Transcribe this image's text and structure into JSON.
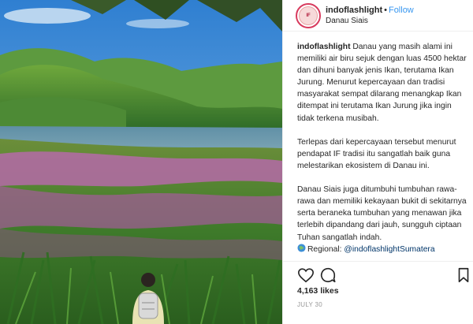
{
  "post": {
    "username": "indoflashlight",
    "follow_label": "Follow",
    "separator": "•",
    "location": "Danau Siais",
    "avatar_mark": "IF",
    "caption": {
      "paragraph1": "Danau yang masih alami ini memiliki air biru sejuk dengan luas 4500 hektar dan dihuni banyak jenis Ikan, terutama Ikan Jurung. Menurut kepercayaan dan tradisi masyarakat sempat dilarang menangkap Ikan ditempat ini terutama Ikan Jurung jika ingin tidak terkena musibah.",
      "paragraph2": "Terlepas dari kepercayaan tersebut menurut pendapat IF tradisi itu sangatlah baik guna melestarikan ekosistem di Danau ini.",
      "paragraph3": "Danau Siais juga ditumbuhi tumbuhan rawa-rawa dan memiliki kekayaan bukit di sekitarnya serta beraneka tumbuhan yang menawan jika terlebih dipandang dari jauh, sungguh ciptaan Tuhan sangatlah indah.",
      "regional_label": "Regional:",
      "regional_tag": "@indoflashlightSumatera"
    },
    "likes": "4,163 likes",
    "date": "JULY 30"
  },
  "colors": {
    "follow": "#3897f0",
    "tag": "#003569",
    "avatar_ring": "#d83b5e"
  },
  "icons": [
    "heart-icon",
    "comment-icon",
    "bookmark-icon",
    "globe-icon"
  ]
}
